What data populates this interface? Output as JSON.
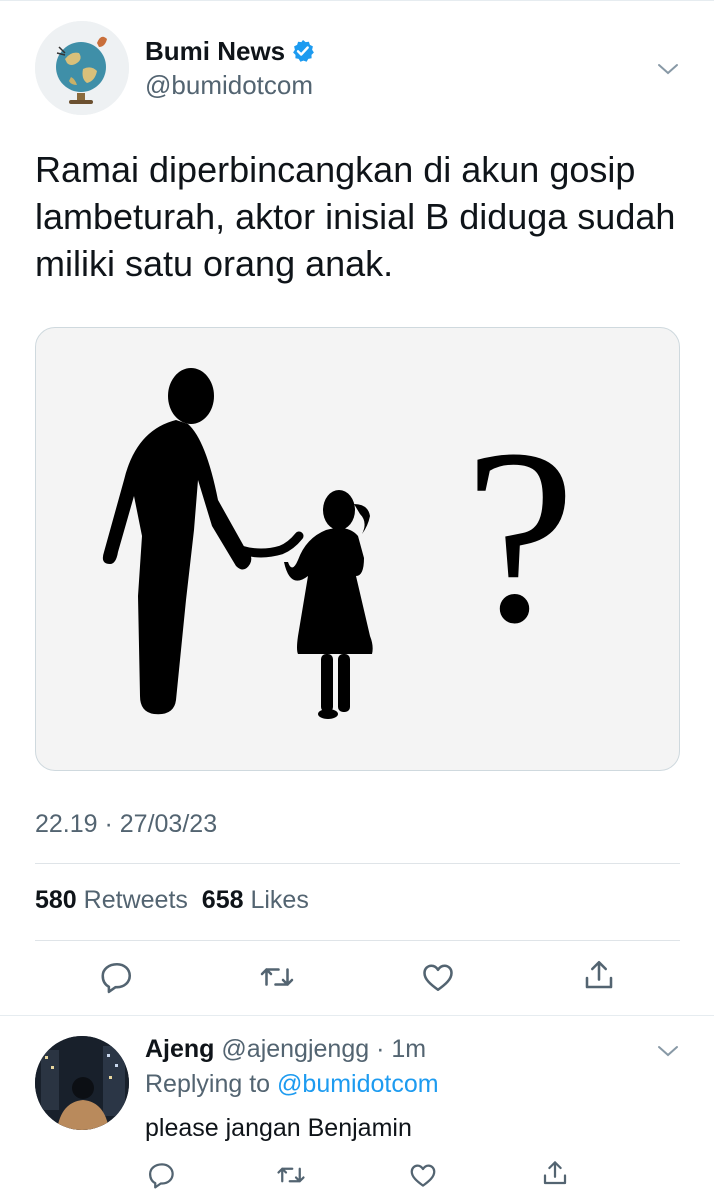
{
  "tweet": {
    "author_name": "Bumi News",
    "handle": "@bumidotcom",
    "verified": true,
    "text": "Ramai diperbincangkan di akun gosip lambeturah, aktor inisial B diduga sudah miliki satu orang anak.",
    "media_glyph": "?",
    "timestamp": "22.19 · 27/03/23",
    "retweets_count": "580",
    "retweets_label": "Retweets",
    "likes_count": "658",
    "likes_label": "Likes",
    "actions": [
      "reply-icon",
      "retweet-icon",
      "like-icon",
      "share-icon"
    ]
  },
  "reply": {
    "author_name": "Ajeng",
    "handle": "@ajengjengg",
    "time": "· 1m",
    "replying_label": "Replying to",
    "replying_mention": "@bumidotcom",
    "text": "please jangan Benjamin",
    "actions": [
      "reply-icon",
      "retweet-icon",
      "like-icon",
      "share-icon"
    ]
  },
  "colors": {
    "accent_blue": "#1d9bf0",
    "secondary_text": "#536471",
    "primary_text": "#0f1419",
    "divider": "#dfe4e8"
  }
}
